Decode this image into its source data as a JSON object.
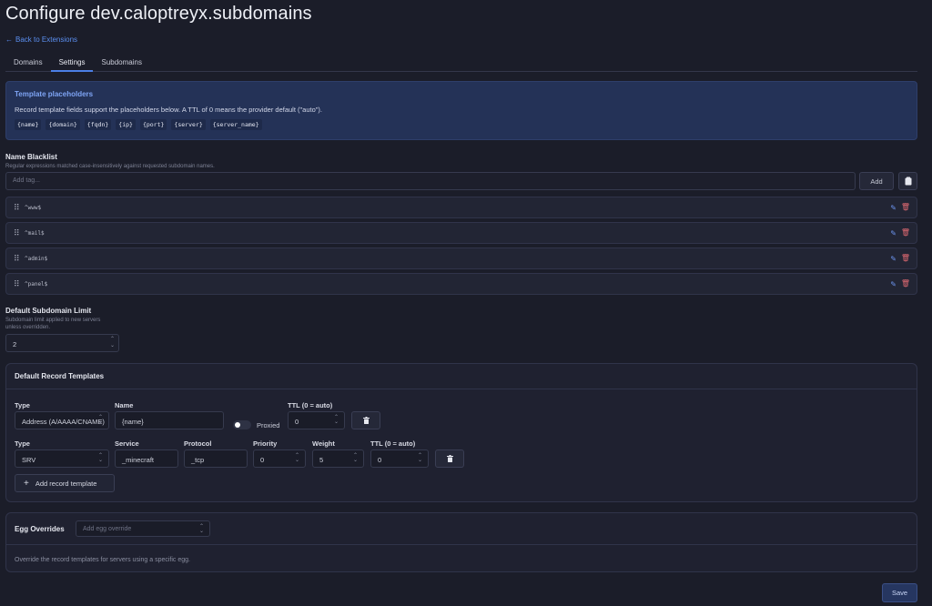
{
  "page": {
    "title": "Configure dev.caloptreyx.subdomains",
    "back_label": "Back to Extensions"
  },
  "tabs": [
    {
      "label": "Domains"
    },
    {
      "label": "Settings",
      "active": true
    },
    {
      "label": "Subdomains"
    }
  ],
  "info": {
    "title": "Template placeholders",
    "text": "Record template fields support the placeholders below. A TTL of 0 means the provider default (\"auto\").",
    "placeholders": [
      "{name}",
      "{domain}",
      "{fqdn}",
      "{ip}",
      "{port}",
      "{server}",
      "{server_name}"
    ]
  },
  "blacklist": {
    "label": "Name Blacklist",
    "help": "Regular expressions matched case-insensitively against requested subdomain names.",
    "placeholder": "Add tag...",
    "add_label": "Add",
    "items": [
      "^www$",
      "^mail$",
      "^admin$",
      "^panel$"
    ]
  },
  "limit": {
    "label": "Default Subdomain Limit",
    "help_line1": "Subdomain limit applied to new servers",
    "help_line2": "unless overridden.",
    "value": "2"
  },
  "templates": {
    "title": "Default Record Templates",
    "row1": {
      "type_label": "Type",
      "type_value": "Address (A/AAAA/CNAME)",
      "name_label": "Name",
      "name_value": "{name}",
      "proxied_label": "Proxied",
      "ttl_label": "TTL (0 = auto)",
      "ttl_value": "0"
    },
    "row2": {
      "type_label": "Type",
      "type_value": "SRV",
      "service_label": "Service",
      "service_value": "_minecraft",
      "protocol_label": "Protocol",
      "protocol_value": "_tcp",
      "priority_label": "Priority",
      "priority_value": "0",
      "weight_label": "Weight",
      "weight_value": "5",
      "ttl_label": "TTL (0 = auto)",
      "ttl_value": "0"
    },
    "add_label": "Add record template"
  },
  "eggs": {
    "title": "Egg Overrides",
    "placeholder": "Add egg override",
    "help": "Override the record templates for servers using a specific egg."
  },
  "save_label": "Save",
  "colors": {
    "accent": "#4b7fe6",
    "danger": "#e06a72",
    "info_bg": "#243257",
    "background": "#1b1d29"
  }
}
